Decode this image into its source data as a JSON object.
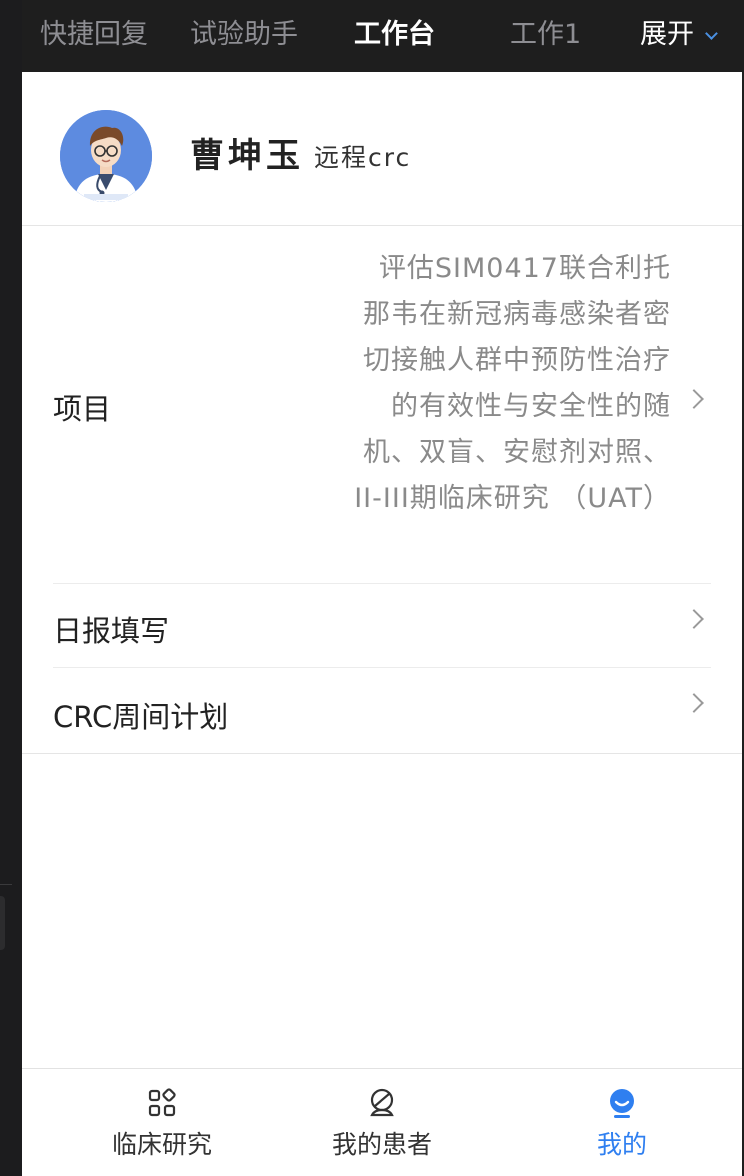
{
  "topbar": {
    "tabs": [
      {
        "label": "快捷回复"
      },
      {
        "label": "试验助手"
      },
      {
        "label": "工作台"
      },
      {
        "label": "工作1"
      }
    ],
    "expand_label": "展开"
  },
  "profile": {
    "name": "曹坤玉",
    "role": "远程crc"
  },
  "rows": {
    "project": {
      "label": "项目",
      "value": "评估SIM0417联合利托那韦在新冠病毒感染者密切接触人群中预防性治疗的有效性与安全性的随机、双盲、安慰剂对照、II-III期临床研究 （UAT）"
    },
    "daily": {
      "label": "日报填写"
    },
    "weekly": {
      "label": "CRC周间计划"
    }
  },
  "bottom_nav": {
    "items": [
      {
        "label": "临床研究",
        "icon": "apps-grid-icon"
      },
      {
        "label": "我的患者",
        "icon": "patient-icon"
      },
      {
        "label": "我的",
        "icon": "profile-icon"
      }
    ]
  },
  "colors": {
    "accent": "#2f7ff0",
    "topbar_bg": "#1e1e1e"
  }
}
